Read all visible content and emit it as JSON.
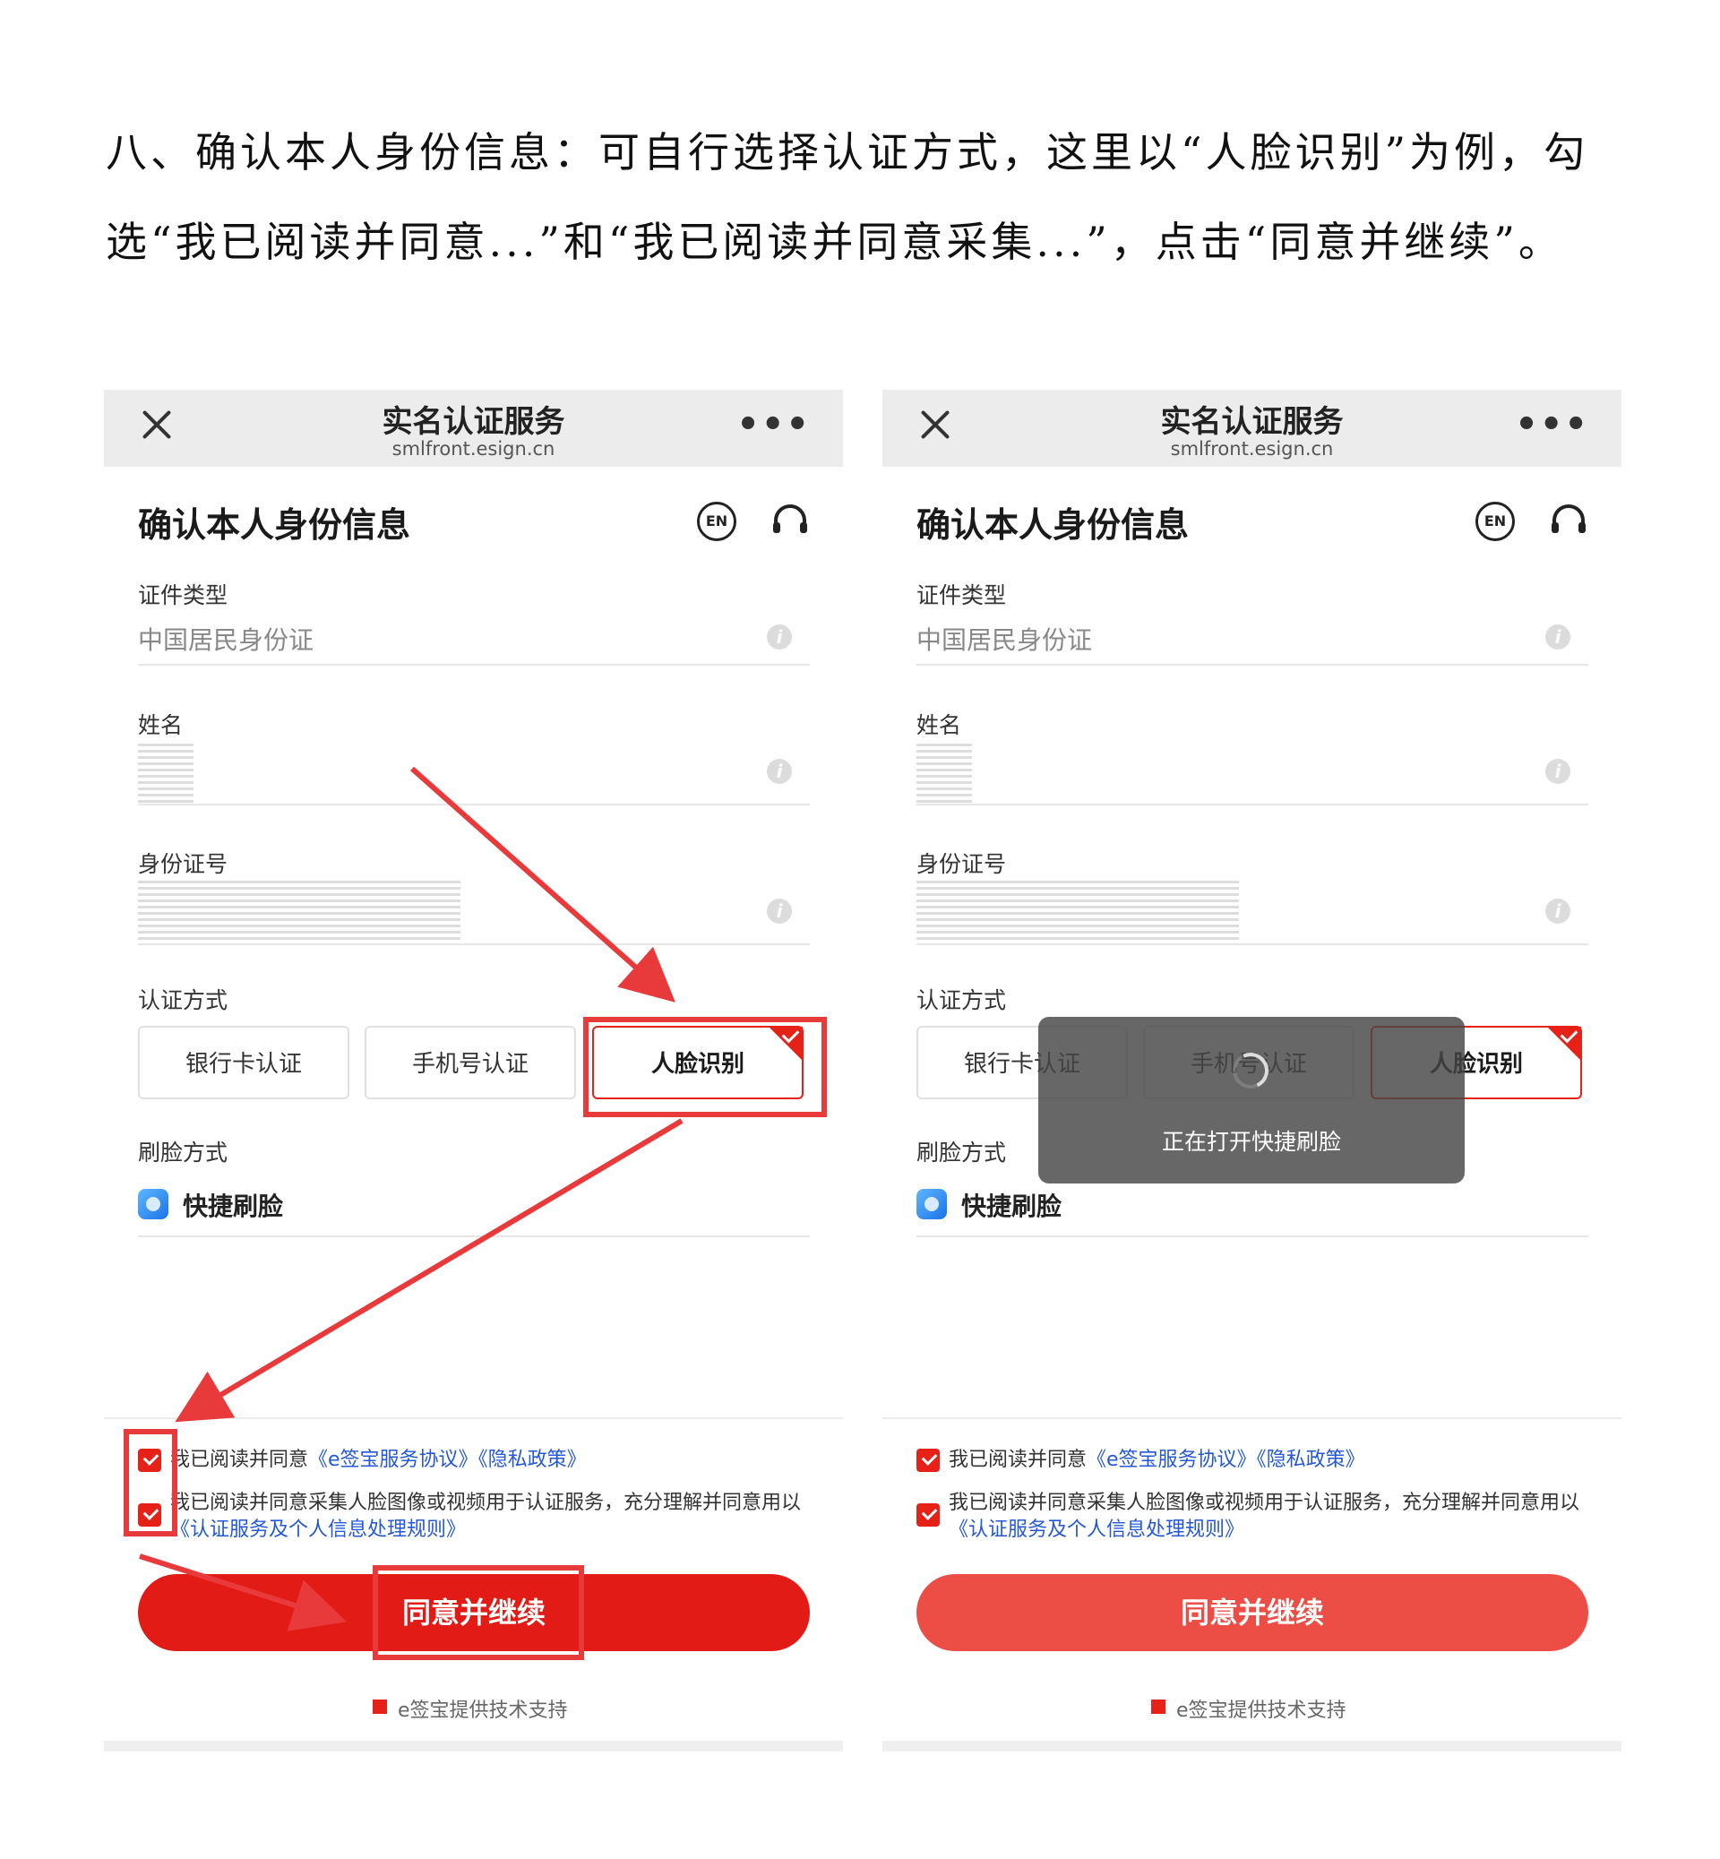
{
  "instruction": "八、确认本人身份信息：可自行选择认证方式，这里以“人脸识别”为例，勾选“我已阅读并同意...”和“我已阅读并同意采集...”，点击“同意并继续”。",
  "screen": {
    "nav_title": "实名认证服务",
    "nav_subtitle": "smlfront.esign.cn",
    "more": "•••",
    "page_title": "确认本人身份信息",
    "en_label": "EN",
    "id_type_label": "证件类型",
    "id_type_value": "中国居民身份证",
    "name_label": "姓名",
    "id_number_label": "身份证号",
    "method_label": "认证方式",
    "methods": [
      "银行卡认证",
      "手机号认证",
      "人脸识别"
    ],
    "selected_method": "人脸识别",
    "face_mode_label": "刷脸方式",
    "face_mode_value": "快捷刷脸",
    "agree1_prefix": "我已阅读并同意",
    "agree1_link1": "《e签宝服务协议》",
    "agree1_link2": "《隐私政策》",
    "agree2_text": "我已阅读并同意采集人脸图像或视频用于认证服务，充分理解并同意用以",
    "agree2_link": "《认证服务及个人信息处理规则》",
    "continue_label": "同意并继续",
    "footer": "e签宝提供技术支持",
    "toast_text": "正在打开快捷刷脸",
    "accent_color": "#e62117",
    "link_color": "#2458d8",
    "annotation_color": "#e83a3a"
  }
}
